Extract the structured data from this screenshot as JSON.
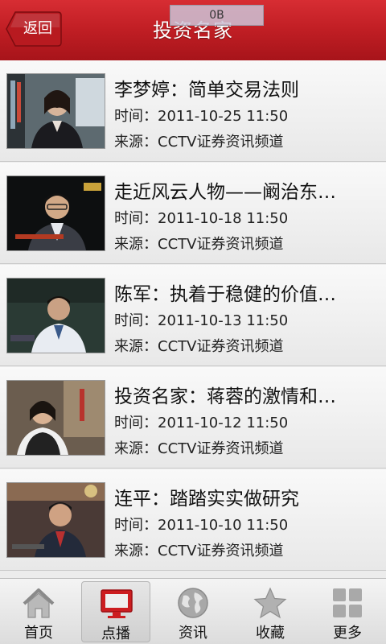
{
  "header": {
    "back_label": "返回",
    "title": "投资名家",
    "speed_badge": "0B",
    "color": "#c01e24"
  },
  "items": [
    {
      "title": "李梦婷：简单交易法则",
      "time": "时间：2011-10-25 11:50",
      "source": "来源：CCTV证券资讯频道"
    },
    {
      "title": "走近风云人物——阚治东…",
      "time": "时间：2011-10-18 11:50",
      "source": "来源：CCTV证券资讯频道"
    },
    {
      "title": "陈军：执着于稳健的价值…",
      "time": "时间：2011-10-13 11:50",
      "source": "来源：CCTV证券资讯频道"
    },
    {
      "title": "投资名家：蒋蓉的激情和…",
      "time": "时间：2011-10-12 11:50",
      "source": "来源：CCTV证券资讯频道"
    },
    {
      "title": "连平：踏踏实实做研究",
      "time": "时间：2011-10-10 11:50",
      "source": "来源：CCTV证券资讯频道"
    }
  ],
  "tabs": [
    {
      "label": "首页",
      "icon": "home-icon",
      "active": false
    },
    {
      "label": "点播",
      "icon": "tv-icon",
      "active": true
    },
    {
      "label": "资讯",
      "icon": "globe-icon",
      "active": false
    },
    {
      "label": "收藏",
      "icon": "star-icon",
      "active": false
    },
    {
      "label": "更多",
      "icon": "grid-icon",
      "active": false
    }
  ]
}
